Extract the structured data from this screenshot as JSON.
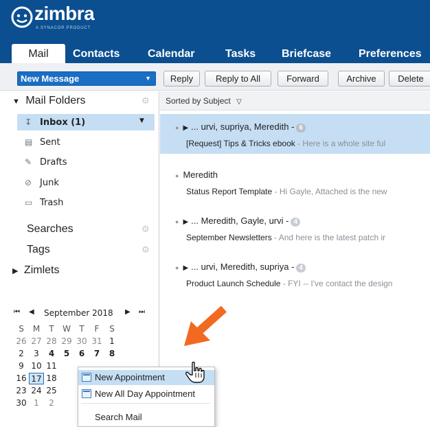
{
  "brand": {
    "name": "zimbra",
    "tagline": "A SYNACOR PRODUCT"
  },
  "nav": {
    "tabs": [
      "Mail",
      "Contacts",
      "Calendar",
      "Tasks",
      "Briefcase",
      "Preferences"
    ],
    "active": "Mail"
  },
  "toolbar": {
    "new_message": "New Message",
    "buttons": [
      "Reply",
      "Reply to All",
      "Forward",
      "Archive",
      "Delete"
    ]
  },
  "sidebar": {
    "mail_folders_header": "Mail Folders",
    "folders": [
      {
        "label": "Inbox (1)",
        "icon": "inbox-icon",
        "selected": true
      },
      {
        "label": "Sent",
        "icon": "sent-icon"
      },
      {
        "label": "Drafts",
        "icon": "drafts-icon"
      },
      {
        "label": "Junk",
        "icon": "junk-icon"
      },
      {
        "label": "Trash",
        "icon": "trash-icon"
      }
    ],
    "searches": "Searches",
    "tags": "Tags",
    "zimlets": "Zimlets"
  },
  "calendar": {
    "month": "September 2018",
    "weekdays": [
      "S",
      "M",
      "T",
      "W",
      "T",
      "F",
      "S"
    ],
    "weeks": [
      [
        "26",
        "27",
        "28",
        "29",
        "30",
        "31",
        "1"
      ],
      [
        "2",
        "3",
        "4",
        "5",
        "6",
        "7",
        "8"
      ],
      [
        "9",
        "10",
        "11",
        "",
        "",
        "",
        ""
      ],
      [
        "16",
        "17",
        "18",
        "",
        "",
        "",
        ""
      ],
      [
        "23",
        "24",
        "25",
        "",
        "",
        "",
        ""
      ],
      [
        "30",
        "1",
        "2",
        "",
        "",
        "",
        ""
      ]
    ],
    "today": "17"
  },
  "list": {
    "sort_label": "Sorted by Subject",
    "conversations": [
      {
        "participants": "... urvi, supriya, Meredith -",
        "count": "6",
        "subject": "[Request] Tips & Tricks ebook",
        "snippet": " - Here is a whole site ful",
        "selected": true,
        "expandable": true
      },
      {
        "participants": "Meredith",
        "count": "",
        "subject": "Status Report Template",
        "snippet": " - Hi Gayle, Attached is the new",
        "selected": false,
        "expandable": false
      },
      {
        "participants": "... Meredith, Gayle, urvi -",
        "count": "4",
        "subject": "September Newsletters",
        "snippet": " - And here is the latest patch ir",
        "selected": false,
        "expandable": true
      },
      {
        "participants": "... urvi, Meredith, supriya -",
        "count": "4",
        "subject": "Product Launch Schedule",
        "snippet": " - FYI -- I've contact the design",
        "selected": false,
        "expandable": true
      }
    ]
  },
  "context_menu": {
    "items": [
      "New Appointment",
      "New All Day Appointment",
      "Search Mail"
    ]
  },
  "colors": {
    "header": "#0b4f90",
    "accent": "#1a6ec3",
    "selection": "#c5def3",
    "arrow": "#f26a21"
  }
}
